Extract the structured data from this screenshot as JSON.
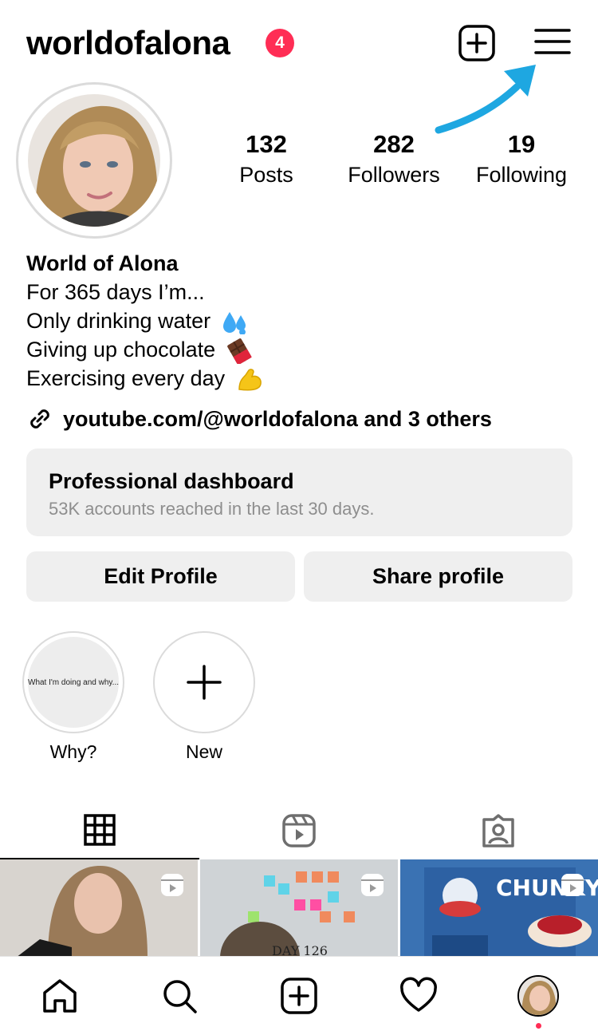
{
  "header": {
    "username": "worldofalona",
    "notification_count": "4",
    "new_post_icon": "plus-square-icon",
    "menu_icon": "hamburger-menu-icon"
  },
  "profile": {
    "stats": [
      {
        "value": "132",
        "label": "Posts"
      },
      {
        "value": "282",
        "label": "Followers"
      },
      {
        "value": "19",
        "label": "Following"
      }
    ],
    "display_name": "World of Alona",
    "bio_lines": [
      "For 365 days I’m...",
      "Only drinking water",
      "Giving up chocolate",
      "Exercising every day"
    ],
    "link_text": "youtube.com/@worldofalona and 3 others"
  },
  "dashboard": {
    "title": "Professional dashboard",
    "subtitle": "53K accounts reached in the last 30 days."
  },
  "buttons": {
    "edit": "Edit Profile",
    "share": "Share profile"
  },
  "highlights": [
    {
      "label": "Why?",
      "cover_text": "What I'm doing and why..."
    },
    {
      "label": "New"
    }
  ],
  "grid_tiles": [
    {
      "overlay_text": ""
    },
    {
      "overlay_text": "DAY 126"
    },
    {
      "overlay_text": "CHUNKY"
    }
  ],
  "colors": {
    "accent": "#ff2d55",
    "arrow": "#1ea7e1",
    "button_bg": "#efefef",
    "secondary_text": "#8e8e8e"
  }
}
